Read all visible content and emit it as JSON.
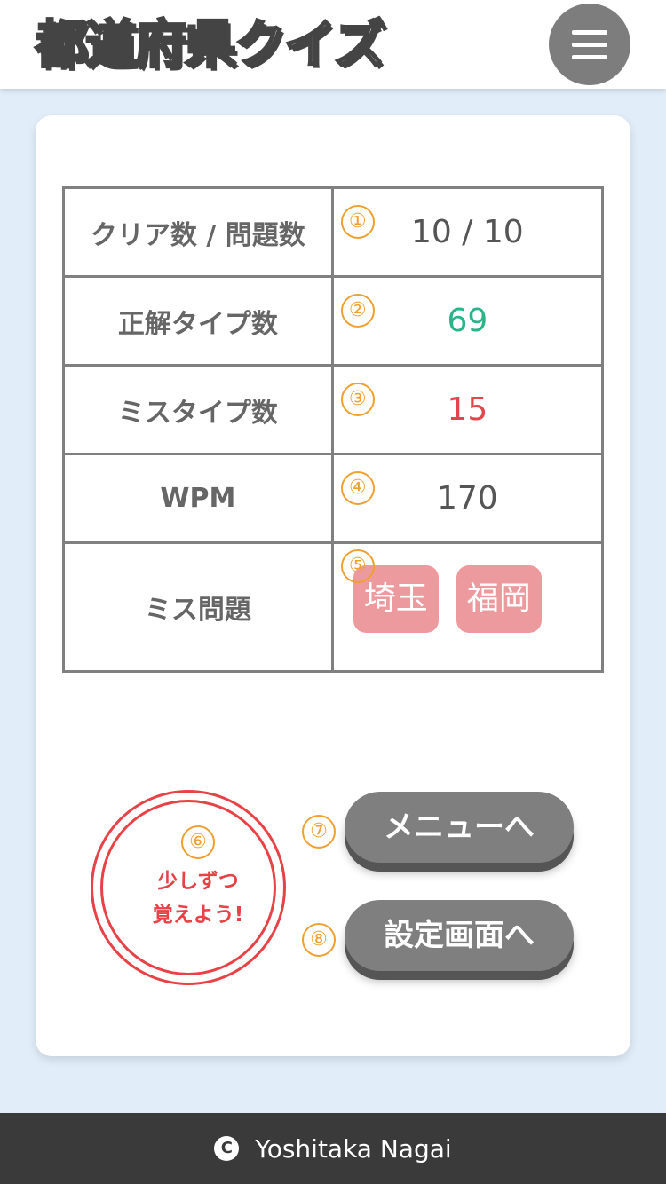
{
  "header": {
    "logo_chars": [
      "都",
      "道",
      "府",
      "県",
      "ク",
      "イ",
      "ズ"
    ],
    "logo_accent_color": "#f3a21d",
    "menu_icon": "hamburger-icon"
  },
  "results": {
    "rows": [
      {
        "marker": "①",
        "label": "クリア数 / 問題数",
        "value": "10 / 10"
      },
      {
        "marker": "②",
        "label": "正解タイプ数",
        "value": "69",
        "color": "#2bb38a"
      },
      {
        "marker": "③",
        "label": "ミスタイプ数",
        "value": "15",
        "color": "#e2474d"
      },
      {
        "marker": "④",
        "label": "WPM",
        "value": "170"
      }
    ],
    "miss": {
      "marker": "⑤",
      "label": "ミス問題",
      "items": [
        "埼玉",
        "福岡"
      ],
      "tag_color": "#ec9a9d"
    }
  },
  "stamp": {
    "marker": "⑥",
    "line1": "少しずつ",
    "line2": "覚えよう!",
    "color": "#e84146"
  },
  "buttons": {
    "menu": {
      "marker": "⑦",
      "label": "メニューへ"
    },
    "settings": {
      "marker": "⑧",
      "label": "設定画面へ"
    }
  },
  "footer": {
    "copyright_symbol": "C",
    "author": "Yoshitaka Nagai"
  }
}
